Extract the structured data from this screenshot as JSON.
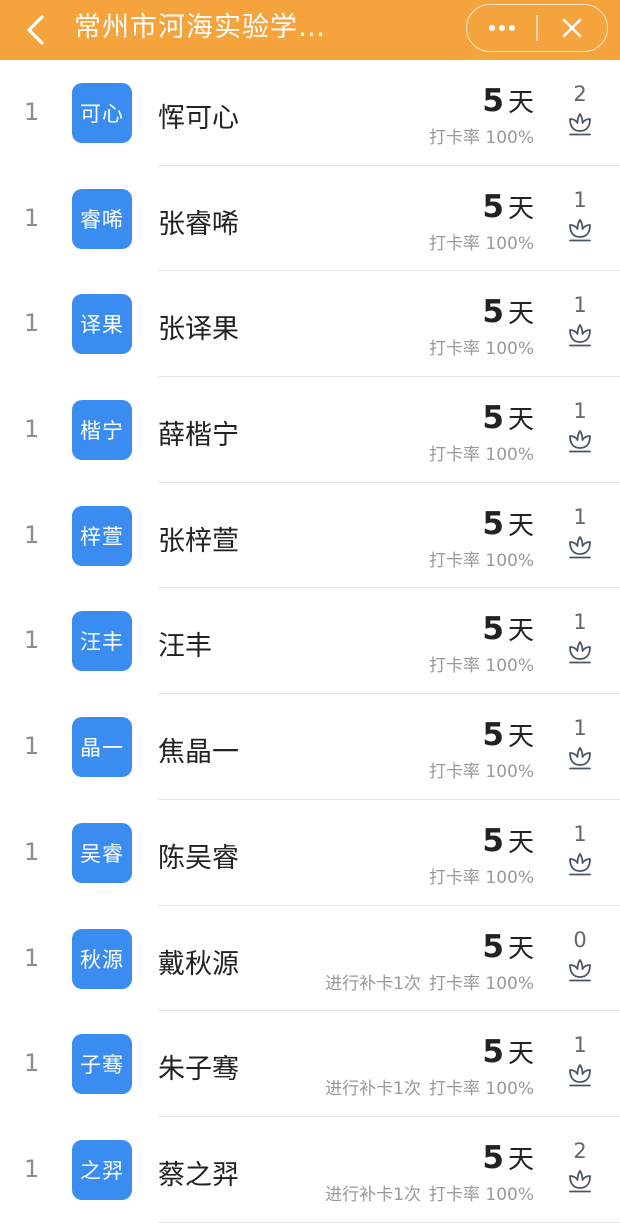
{
  "header": {
    "title": "常州市河海实验学…",
    "bg_color": "#f5a33c"
  },
  "icons": {
    "back": "chevron-left-icon",
    "more": "more-dots-icon",
    "close": "close-icon",
    "like": "flower-icon"
  },
  "labels": {
    "rate_prefix": "打卡率",
    "day_unit": "天"
  },
  "rows": [
    {
      "rank": "1",
      "avatar": "可心",
      "name": "恽可心",
      "days": "5",
      "makeup": "",
      "rate": "100%",
      "likes": "2"
    },
    {
      "rank": "1",
      "avatar": "睿唏",
      "name": "张睿唏",
      "days": "5",
      "makeup": "",
      "rate": "100%",
      "likes": "1"
    },
    {
      "rank": "1",
      "avatar": "译果",
      "name": "张译果",
      "days": "5",
      "makeup": "",
      "rate": "100%",
      "likes": "1"
    },
    {
      "rank": "1",
      "avatar": "楷宁",
      "name": "薛楷宁",
      "days": "5",
      "makeup": "",
      "rate": "100%",
      "likes": "1"
    },
    {
      "rank": "1",
      "avatar": "梓萱",
      "name": "张梓萱",
      "days": "5",
      "makeup": "",
      "rate": "100%",
      "likes": "1"
    },
    {
      "rank": "1",
      "avatar": "汪丰",
      "name": "汪丰",
      "days": "5",
      "makeup": "",
      "rate": "100%",
      "likes": "1"
    },
    {
      "rank": "1",
      "avatar": "晶一",
      "name": "焦晶一",
      "days": "5",
      "makeup": "",
      "rate": "100%",
      "likes": "1"
    },
    {
      "rank": "1",
      "avatar": "吴睿",
      "name": "陈吴睿",
      "days": "5",
      "makeup": "",
      "rate": "100%",
      "likes": "1"
    },
    {
      "rank": "1",
      "avatar": "秋源",
      "name": "戴秋源",
      "days": "5",
      "makeup": "进行补卡1次",
      "rate": "100%",
      "likes": "0"
    },
    {
      "rank": "1",
      "avatar": "子骞",
      "name": "朱子骞",
      "days": "5",
      "makeup": "进行补卡1次",
      "rate": "100%",
      "likes": "1"
    },
    {
      "rank": "1",
      "avatar": "之羿",
      "name": "蔡之羿",
      "days": "5",
      "makeup": "进行补卡1次",
      "rate": "100%",
      "likes": "2"
    }
  ]
}
